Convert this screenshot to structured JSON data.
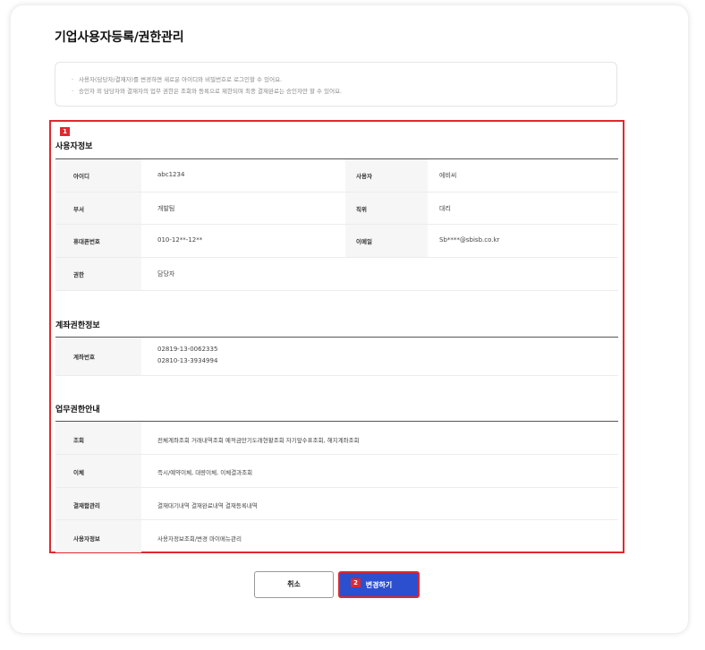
{
  "page": {
    "title": "기업사용자등록/권한관리",
    "notices": [
      "사용자(담당자/결재자)를 변경하면 새로운 아이디와 비밀번호로 로그인할 수 있어요.",
      "승인자 외 담당자와 결재자의 업무 권한은 조회와 등록으로 제한되며 최종 결재완료는 승인자만 할 수 있어요."
    ],
    "notice_bullet": "·"
  },
  "markers": {
    "section": "1",
    "button": "2",
    "color": "#e0282e"
  },
  "user_info": {
    "title": "사용자정보",
    "fields": {
      "id_label": "아이디",
      "id_value": "abc1234",
      "user_label": "사용자",
      "user_value": "에비씨",
      "dept_label": "부서",
      "dept_value": "개발팀",
      "position_label": "직위",
      "position_value": "대리",
      "phone_label": "휴대폰번호",
      "phone_value": "010-12**-12**",
      "email_label": "이메일",
      "email_value": "Sb****@sbisb.co.kr",
      "role_label": "권한",
      "role_value": "담당자"
    }
  },
  "account_info": {
    "title": "계좌권한정보",
    "label": "계좌번호",
    "accounts": [
      "02819-13-0062335",
      "02810-13-3934994"
    ]
  },
  "work_info": {
    "title": "업무권한안내",
    "rows": [
      {
        "label": "조회",
        "value": "전체계좌조회 거래내역조회 예적금만기도래현황조회 자기앞수표조회, 해지계좌조회"
      },
      {
        "label": "이체",
        "value": "즉시/예약이체, 대량이체, 이체결과조회"
      },
      {
        "label": "결재함관리",
        "value": "결재대기내역 결재완료내역 결재등록내역"
      },
      {
        "label": "사용자정보",
        "value": "사용자정보조회/변경 마이메뉴관리"
      }
    ]
  },
  "buttons": {
    "cancel": "취소",
    "submit": "변경하기",
    "submit_color": "#2b4fcf"
  }
}
